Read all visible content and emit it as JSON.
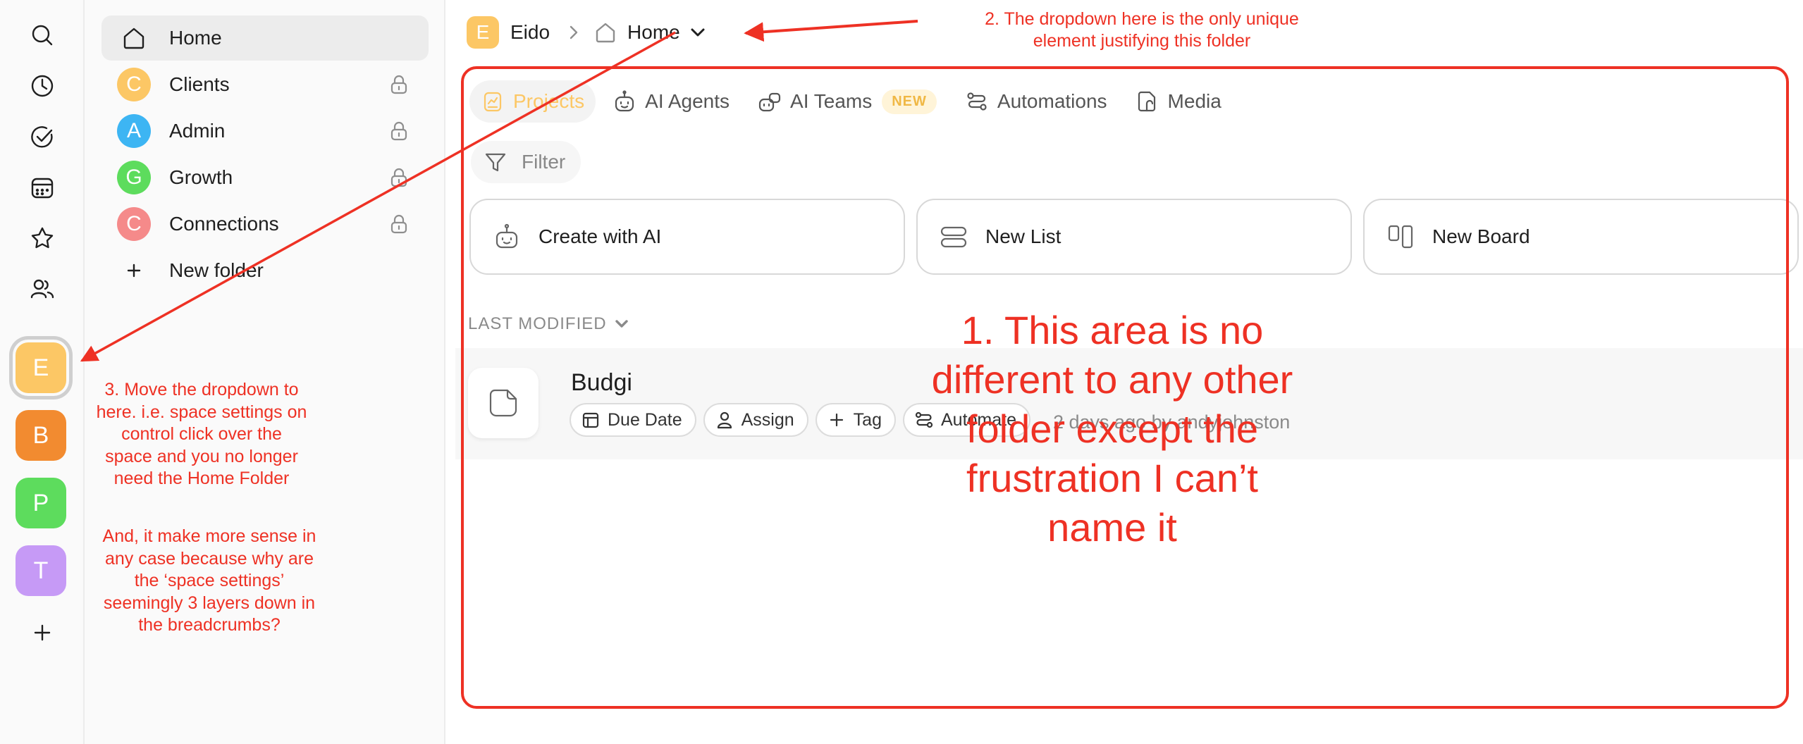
{
  "rail": {
    "icons": [
      "search-icon",
      "clock-icon",
      "check-circle-icon",
      "calendar-icon",
      "star-icon",
      "users-icon"
    ],
    "spaces": [
      {
        "letter": "E",
        "color": "#fcc765",
        "active": true
      },
      {
        "letter": "B",
        "color": "#f28b30"
      },
      {
        "letter": "P",
        "color": "#5ddc5d"
      },
      {
        "letter": "T",
        "color": "#c69af6"
      }
    ],
    "add_icon": "plus-icon"
  },
  "sidebar": {
    "folders": [
      {
        "label": "Home",
        "icon": "home-icon",
        "selected": true
      },
      {
        "label": "Clients",
        "letter": "C",
        "color": "#fcc765",
        "locked": true
      },
      {
        "label": "Admin",
        "letter": "A",
        "color": "#3db5f3",
        "locked": true
      },
      {
        "label": "Growth",
        "letter": "G",
        "color": "#5ddc5d",
        "locked": true
      },
      {
        "label": "Connections",
        "letter": "C",
        "color": "#f58a8a",
        "locked": true
      },
      {
        "label": "New folder",
        "icon": "plus-icon"
      }
    ]
  },
  "breadcrumb": {
    "space_letter": "E",
    "space_name": "Eido",
    "folder": "Home"
  },
  "tabs": [
    {
      "label": "Projects",
      "active": true
    },
    {
      "label": "AI Agents"
    },
    {
      "label": "AI Teams",
      "badge": "NEW"
    },
    {
      "label": "Automations"
    },
    {
      "label": "Media"
    }
  ],
  "filter_label": "Filter",
  "create_cards": [
    "Create with AI",
    "New List",
    "New Board"
  ],
  "sort_label": "LAST MODIFIED",
  "project": {
    "name": "Budgi",
    "chips": [
      "Due Date",
      "Assign",
      "Tag",
      "Automate"
    ],
    "meta": "2 days ago by andyjohnston"
  },
  "annotations": {
    "note1": "1. This area is no different to any other folder except the frustration I can’t name it",
    "note2": "2. The dropdown here is the only unique element justifying this folder",
    "note3": "3. Move the dropdown to here. i.e. space settings on control click over the space and you no longer need the Home Folder",
    "note4": "And, it make more sense in any case because why are the ‘space settings’ seemingly 3 layers down in the breadcrumbs?"
  },
  "colors": {
    "accent": "#fcc765",
    "annotation": "#ee3124"
  }
}
